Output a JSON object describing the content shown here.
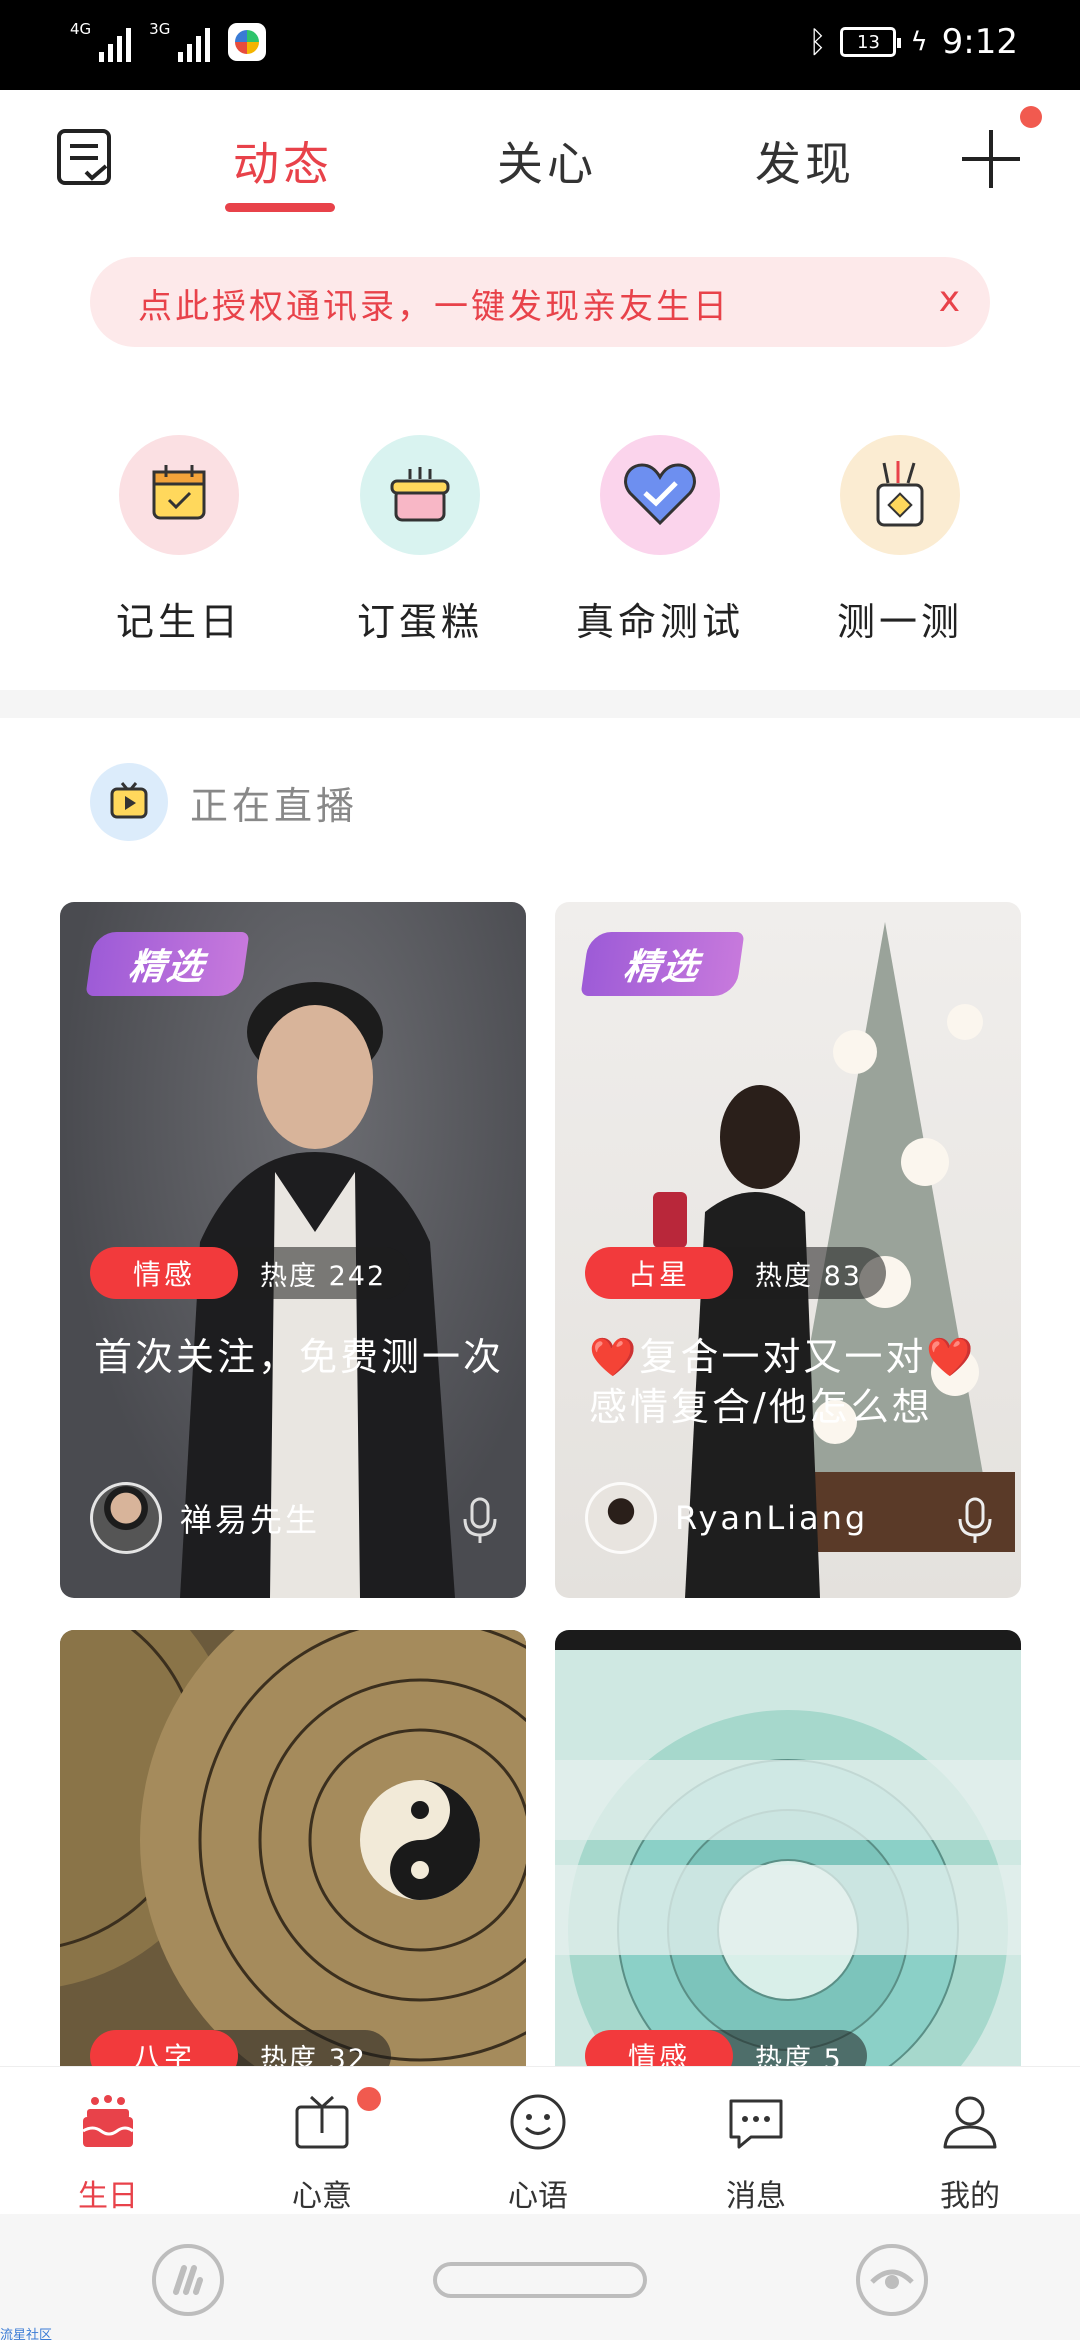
{
  "status_bar": {
    "signal1_label": "4G",
    "signal2_label": "3G",
    "battery": "13",
    "time": "9:12"
  },
  "top_nav": {
    "tabs": [
      {
        "label": "动态",
        "active": true
      },
      {
        "label": "关心",
        "active": false
      },
      {
        "label": "发现",
        "active": false
      }
    ],
    "plus_has_badge": true
  },
  "banner": {
    "text": "点此授权通讯录，一键发现亲友生日",
    "close": "x"
  },
  "shortcuts": [
    {
      "label": "记生日",
      "icon": "calendar-icon",
      "bg": "#fbe0e3"
    },
    {
      "label": "订蛋糕",
      "icon": "cake-icon",
      "bg": "#d9f3f0"
    },
    {
      "label": "真命测试",
      "icon": "heart-icon",
      "bg": "#fbd4ec"
    },
    {
      "label": "测一测",
      "icon": "divination-icon",
      "bg": "#fbecd2"
    }
  ],
  "live": {
    "title": "正在直播"
  },
  "cards": [
    {
      "pick": "精选",
      "tag": "情感",
      "heat": "热度 242",
      "title": "首次关注，免费测一次",
      "author": "禅易先生",
      "has_pick": true
    },
    {
      "pick": "精选",
      "tag": "占星",
      "heat": "热度 83",
      "title": "❤️复合一对又一对❤️感情复合/他怎么想",
      "author": "RyanLiang",
      "has_pick": true
    },
    {
      "tag": "八字",
      "heat": "热度 32",
      "has_pick": false
    },
    {
      "tag": "情感",
      "heat": "热度 5",
      "has_pick": false
    }
  ],
  "tabbar": [
    {
      "label": "生日",
      "icon": "cake-tab-icon",
      "active": true
    },
    {
      "label": "心意",
      "icon": "gift-icon",
      "active": false,
      "badge": true
    },
    {
      "label": "心语",
      "icon": "smile-icon",
      "active": false
    },
    {
      "label": "消息",
      "icon": "message-icon",
      "active": false
    },
    {
      "label": "我的",
      "icon": "user-icon",
      "active": false
    }
  ],
  "watermark": "流星社区",
  "colors": {
    "accent": "#e8424a",
    "tag_red": "#f23a3c",
    "badge": "#f15a4f",
    "pick_purple": "#9d5bd7"
  }
}
